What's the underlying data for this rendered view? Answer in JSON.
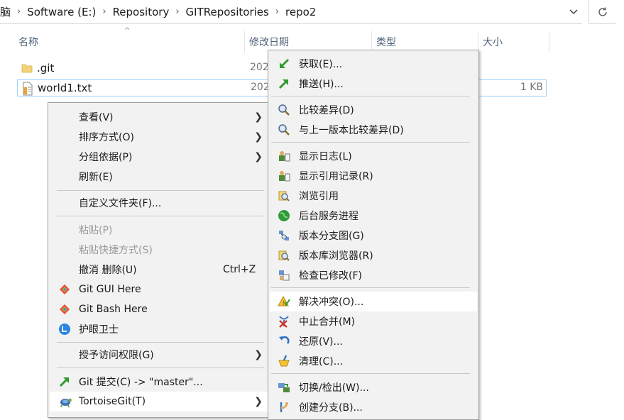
{
  "address": {
    "partial": "脑",
    "crumbs": [
      "Software (E:)",
      "Repository",
      "GITRepositories",
      "repo2"
    ],
    "dropdown_icon": "chevron-down-icon",
    "refresh_icon": "refresh-icon"
  },
  "columns": [
    "名称",
    "修改日期",
    "类型",
    "大小"
  ],
  "files": [
    {
      "name": ".git",
      "date": "202",
      "size": "",
      "icon": "folder-icon"
    },
    {
      "name": "world1.txt",
      "date": "202",
      "size": "1 KB",
      "icon": "text-file-icon"
    }
  ],
  "context_menu": {
    "items": [
      {
        "label": "查看(V)",
        "submenu": true
      },
      {
        "label": "排序方式(O)",
        "submenu": true
      },
      {
        "label": "分组依据(P)",
        "submenu": true
      },
      {
        "label": "刷新(E)"
      },
      {
        "sep": true
      },
      {
        "label": "自定义文件夹(F)..."
      },
      {
        "sep": true
      },
      {
        "label": "粘贴(P)",
        "disabled": true
      },
      {
        "label": "粘贴快捷方式(S)",
        "disabled": true
      },
      {
        "label": "撤消 删除(U)",
        "shortcut": "Ctrl+Z"
      },
      {
        "label": "Git GUI Here",
        "icon": "git-diamond-icon"
      },
      {
        "label": "Git Bash Here",
        "icon": "git-diamond-icon"
      },
      {
        "label": "护眼卫士",
        "icon": "eye-guard-icon"
      },
      {
        "sep": true
      },
      {
        "label": "授予访问权限(G)",
        "submenu": true
      },
      {
        "sep": true
      },
      {
        "label": "Git 提交(C) -> \"master\"...",
        "icon": "git-commit-icon"
      },
      {
        "label": "TortoiseGit(T)",
        "icon": "tortoisegit-icon",
        "submenu": true,
        "hover": true
      }
    ]
  },
  "submenu": {
    "items": [
      {
        "label": "获取(E)...",
        "icon": "pull-arrow-icon"
      },
      {
        "label": "推送(H)...",
        "icon": "push-arrow-icon"
      },
      {
        "sep": true
      },
      {
        "label": "比较差异(D)",
        "icon": "diff-magnifier-icon"
      },
      {
        "label": "与上一版本比较差异(D)",
        "icon": "diff-magnifier-icon"
      },
      {
        "sep": true
      },
      {
        "label": "显示日志(L)",
        "icon": "log-icon"
      },
      {
        "label": "显示引用记录(R)",
        "icon": "reflog-icon"
      },
      {
        "label": "浏览引用",
        "icon": "browse-refs-icon"
      },
      {
        "label": "后台服务进程",
        "icon": "daemon-globe-icon"
      },
      {
        "label": "版本分支图(G)",
        "icon": "revision-graph-icon"
      },
      {
        "label": "版本库浏览器(R)",
        "icon": "repo-browser-icon"
      },
      {
        "label": "检查已修改(F)",
        "icon": "check-modified-icon"
      },
      {
        "sep": true
      },
      {
        "label": "解决冲突(O)...",
        "icon": "resolve-conflict-icon",
        "hover": true
      },
      {
        "label": "中止合并(M)",
        "icon": "abort-merge-icon"
      },
      {
        "label": "还原(V)...",
        "icon": "revert-icon"
      },
      {
        "label": "清理(C)...",
        "icon": "cleanup-icon"
      },
      {
        "sep": true
      },
      {
        "label": "切换/检出(W)...",
        "icon": "switch-checkout-icon"
      },
      {
        "label": "创建分支(B)...",
        "icon": "create-branch-icon"
      }
    ]
  }
}
